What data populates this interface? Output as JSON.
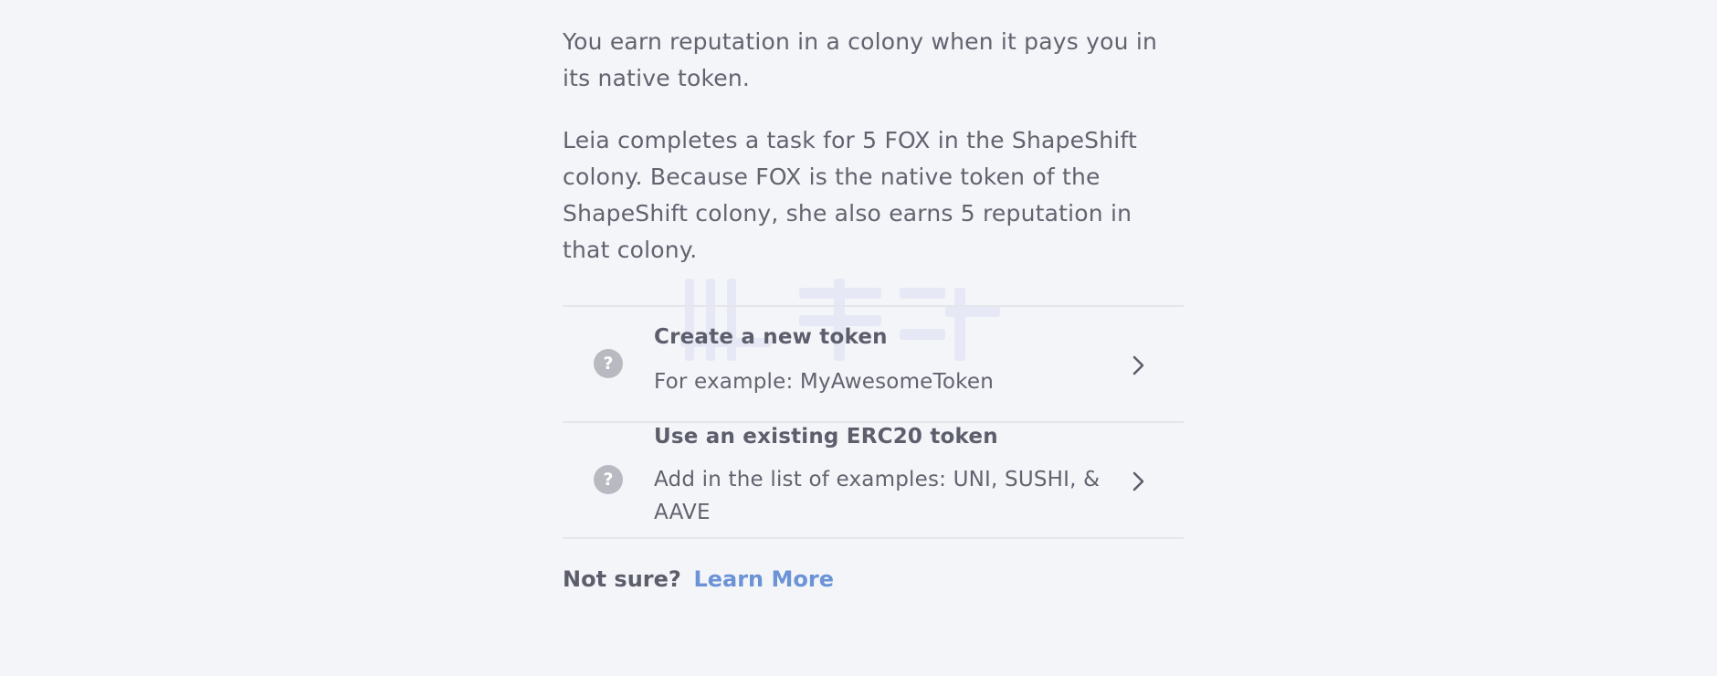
{
  "intro": {
    "paragraph_1": "You earn reputation in a colony when it pays you in its native token.",
    "paragraph_2": "Leia completes a task for 5 FOX in the ShapeShift colony. Because FOX is the native token of the ShapeShift colony, she also earns 5 reputation in that colony."
  },
  "options": [
    {
      "icon": "help-icon",
      "icon_glyph": "?",
      "title": "Create a new token",
      "description": "For example: MyAwesomeToken",
      "chevron": "chevron-right-icon"
    },
    {
      "icon": "help-icon",
      "icon_glyph": "?",
      "title": "Use an existing ERC20 token",
      "description": "Add in the list of examples: UNI, SUSHI, & AAVE",
      "chevron": "chevron-right-icon"
    }
  ],
  "footer": {
    "not_sure": "Not sure?",
    "learn_more": "Learn More"
  },
  "colors": {
    "background": "#f4f5f9",
    "text": "#5d5e6c",
    "link": "#6b93d6",
    "divider": "#e4e6ec",
    "icon_bg": "#b9bac1"
  }
}
